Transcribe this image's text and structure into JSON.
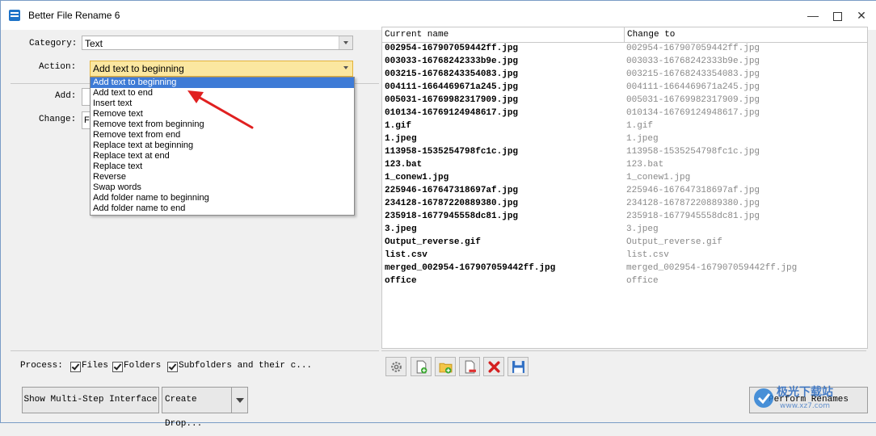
{
  "window": {
    "title": "Better File Rename 6"
  },
  "left_panel": {
    "category_label": "Category:",
    "category_value": "Text",
    "action_label": "Action:",
    "action_value": "Add text to beginning",
    "add_label": "Add:",
    "change_label": "Change:",
    "change_value": "Fi",
    "dropdown_items": [
      "Add text to beginning",
      "Add text to end",
      "Insert text",
      "Remove text",
      "Remove text from beginning",
      "Remove text from end",
      "Replace text at beginning",
      "Replace text at end",
      "Replace text",
      "Reverse",
      "Swap words",
      "Add folder name to beginning",
      "Add folder name to end"
    ],
    "selected_item": "Add text to beginning"
  },
  "process": {
    "label": "Process:",
    "files": "Files",
    "folders": "Folders",
    "subfolders": "Subfolders and their c...",
    "files_checked": true,
    "folders_checked": true,
    "subfolders_checked": true
  },
  "buttons": {
    "multi_step": "Show Multi-Step Interface",
    "create_drop": "Create Drop...",
    "perform": "Perform Renames"
  },
  "grid": {
    "col_current": "Current name",
    "col_change": "Change to",
    "rows": [
      {
        "current": "002954-167907059442ff.jpg",
        "change": "002954-167907059442ff.jpg"
      },
      {
        "current": "003033-16768242333b9e.jpg",
        "change": "003033-16768242333b9e.jpg"
      },
      {
        "current": "003215-16768243354083.jpg",
        "change": "003215-16768243354083.jpg"
      },
      {
        "current": "004111-1664469671a245.jpg",
        "change": "004111-1664469671a245.jpg"
      },
      {
        "current": "005031-16769982317909.jpg",
        "change": "005031-16769982317909.jpg"
      },
      {
        "current": "010134-16769124948617.jpg",
        "change": "010134-16769124948617.jpg"
      },
      {
        "current": "1.gif",
        "change": "1.gif"
      },
      {
        "current": "1.jpeg",
        "change": "1.jpeg"
      },
      {
        "current": "113958-1535254798fc1c.jpg",
        "change": "113958-1535254798fc1c.jpg"
      },
      {
        "current": "123.bat",
        "change": "123.bat"
      },
      {
        "current": "1_conew1.jpg",
        "change": "1_conew1.jpg"
      },
      {
        "current": "225946-167647318697af.jpg",
        "change": "225946-167647318697af.jpg"
      },
      {
        "current": "234128-16787220889380.jpg",
        "change": "234128-16787220889380.jpg"
      },
      {
        "current": "235918-1677945558dc81.jpg",
        "change": "235918-1677945558dc81.jpg"
      },
      {
        "current": "3.jpeg",
        "change": "3.jpeg"
      },
      {
        "current": "Output_reverse.gif",
        "change": "Output_reverse.gif"
      },
      {
        "current": "list.csv",
        "change": "list.csv"
      },
      {
        "current": "merged_002954-167907059442ff.jpg",
        "change": "merged_002954-167907059442ff.jpg"
      },
      {
        "current": "office",
        "change": "office"
      }
    ]
  },
  "toolbar_icons": [
    "settings-icon",
    "add-file-icon",
    "add-folder-icon",
    "remove-file-icon",
    "delete-icon",
    "save-icon"
  ],
  "watermark": "极光下载站"
}
